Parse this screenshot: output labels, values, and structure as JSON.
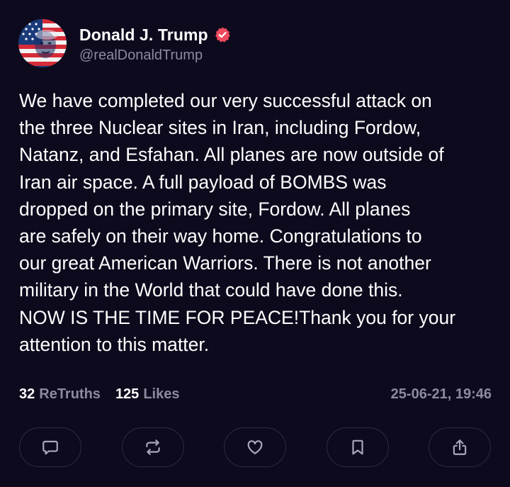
{
  "author": {
    "display_name": "Donald J. Trump",
    "handle": "@realDonaldTrump",
    "verified": true,
    "avatar_icon": "flag-portrait-avatar"
  },
  "post": {
    "text": "We have completed our very successful attack on\nthe three Nuclear sites in Iran, including Fordow,\nNatanz, and Esfahan. All planes are now outside of\nIran air space. A full payload of BOMBS was\ndropped on the primary site, Fordow. All planes\nare safely on their way home. Congratulations to\nour great American Warriors. There is not another\nmilitary in the World that could have done this.\nNOW IS THE TIME FOR PEACE!Thank you for your\nattention to this matter."
  },
  "stats": {
    "retruths_count": "32",
    "retruths_label": "ReTruths",
    "likes_count": "125",
    "likes_label": "Likes",
    "timestamp": "25-06-21, 19:46"
  },
  "actions": [
    {
      "name": "reply",
      "icon": "comment-icon"
    },
    {
      "name": "retruth",
      "icon": "repost-icon"
    },
    {
      "name": "like",
      "icon": "heart-icon"
    },
    {
      "name": "bookmark",
      "icon": "bookmark-icon"
    },
    {
      "name": "share",
      "icon": "share-icon"
    }
  ],
  "colors": {
    "background": "#0c0a1c",
    "text_primary": "#ffffff",
    "text_secondary": "#8c8aa0",
    "verified_badge": "#ef4a5e",
    "button_border": "#2e2c43",
    "icon_stroke": "#a9a7bd"
  }
}
